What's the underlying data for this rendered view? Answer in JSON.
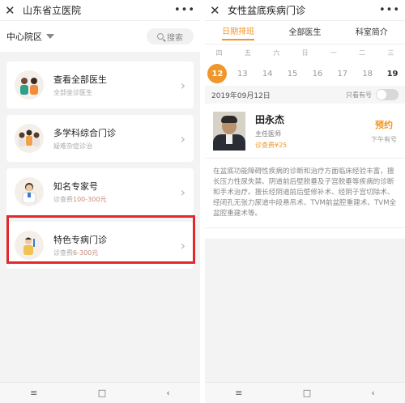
{
  "left": {
    "title": "山东省立医院",
    "campus": "中心院区",
    "search_placeholder": "搜索",
    "cards": [
      {
        "title": "查看全部医生",
        "subtitle": "全部坐诊医生",
        "fee": ""
      },
      {
        "title": "多学科综合门诊",
        "subtitle": "疑难杂症诊治",
        "fee": ""
      },
      {
        "title": "知名专家号",
        "subtitle": "诊查费",
        "fee": "100-300元"
      },
      {
        "title": "特色专病门诊",
        "subtitle": "诊查费",
        "fee": "6-300元"
      }
    ]
  },
  "right": {
    "title": "女性盆底疾病门诊",
    "tabs": [
      "日期排班",
      "全部医生",
      "科室简介"
    ],
    "weekdays": [
      "四",
      "五",
      "六",
      "日",
      "一",
      "二",
      "三"
    ],
    "dates": [
      "12",
      "13",
      "14",
      "15",
      "16",
      "17",
      "18",
      "19"
    ],
    "selected_date": "2019年09月12日",
    "only_available_label": "只看有号",
    "doctor": {
      "name": "田永杰",
      "title": "主任医师",
      "fee": "诊查费¥25",
      "book_label": "预约",
      "period": "下午有号"
    },
    "description": "在盆底功能障碍性疾病的诊断和治疗方面临床经验丰富，擅长压力性尿失禁、阴道前后壁脱垂及子宫脱垂等疾病的诊断和手术治疗。擅长经阴道前后壁修补术、经阴子宫切除术、经闭孔无张力尿道中段悬吊术、TVM前盆腔重建术、TVM全盆腔重建术等。"
  },
  "navbar": {
    "menu": "≡",
    "home": "□",
    "back": "‹"
  },
  "colors": {
    "accent": "#f0962a",
    "highlight": "#e4272a"
  }
}
